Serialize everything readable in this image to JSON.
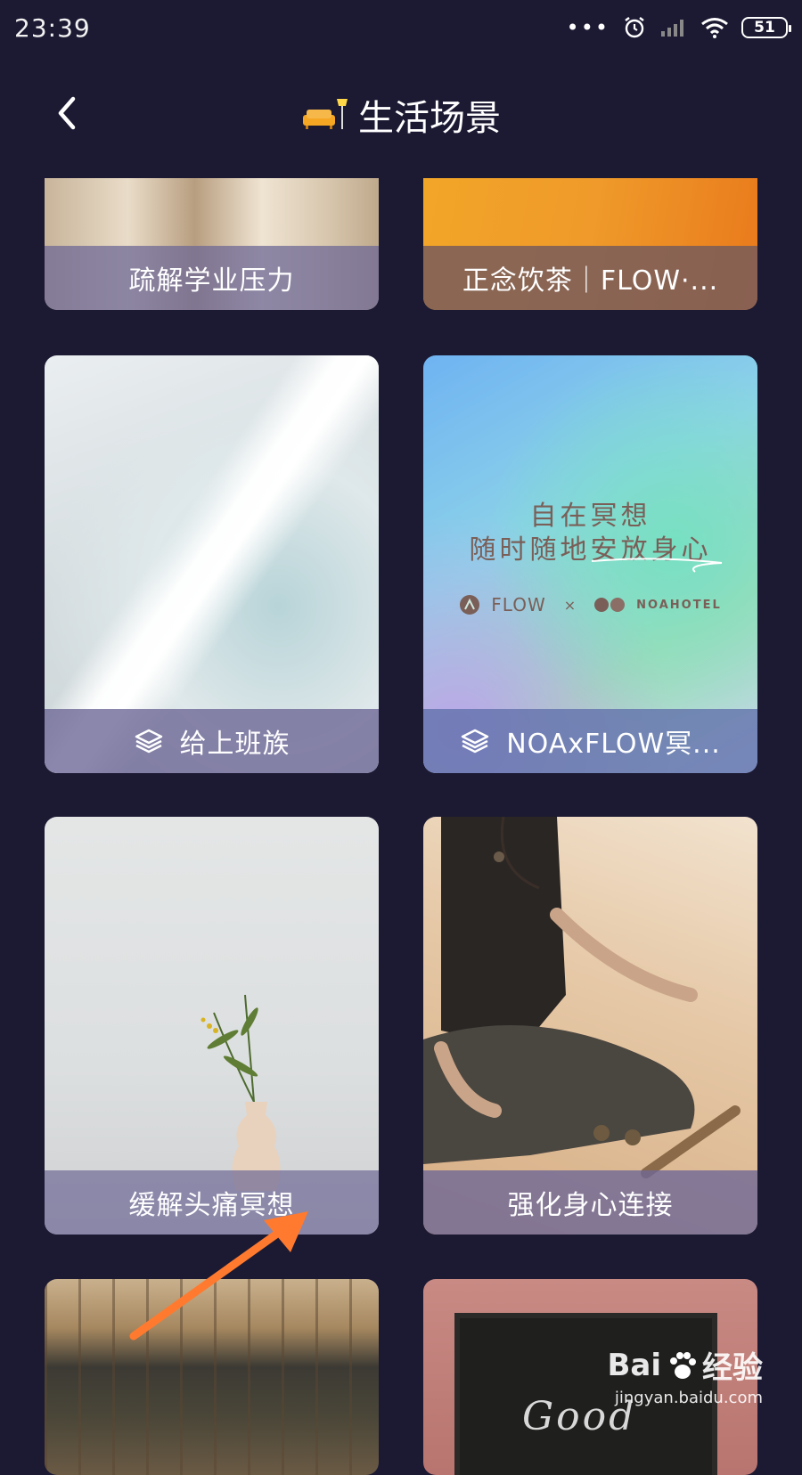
{
  "status_bar": {
    "time": "23:39",
    "battery": "51",
    "icons": [
      "more-dots-icon",
      "alarm-icon",
      "signal-icon",
      "wifi-icon",
      "battery-icon"
    ]
  },
  "header": {
    "title": "生活场景",
    "title_icon": "sofa-lamp-icon",
    "back_icon": "chevron-left-icon"
  },
  "cards": [
    {
      "label": "疏解学业压力",
      "has_collection_icon": false
    },
    {
      "label": "正念饮茶｜FLOW·...",
      "has_collection_icon": false
    },
    {
      "label": "给上班族",
      "has_collection_icon": true
    },
    {
      "label": "NOAxFLOW冥...",
      "has_collection_icon": true,
      "poster": {
        "line1": "自在冥想",
        "line2": "随时随地安放身心",
        "brand_left": "FLOW",
        "brand_sep": "×",
        "brand_right": "NOAHOTEL"
      }
    },
    {
      "label": "缓解头痛冥想",
      "has_collection_icon": false
    },
    {
      "label": "强化身心连接",
      "has_collection_icon": false
    },
    {
      "label": "",
      "has_collection_icon": false
    },
    {
      "label": "",
      "has_collection_icon": false,
      "chalk_text": "Good"
    }
  ],
  "watermark": {
    "brand": "Bai",
    "brand_cn": "经验",
    "url": "jingyan.baidu.com"
  },
  "colors": {
    "background": "#1c1a33",
    "arrow": "#ff7a2e"
  }
}
